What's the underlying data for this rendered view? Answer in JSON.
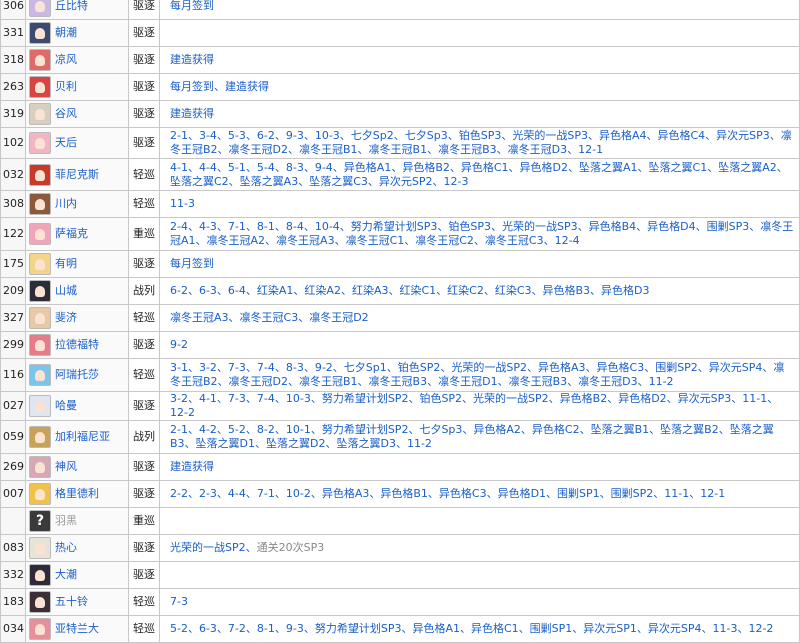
{
  "table": {
    "rows": [
      {
        "id": "306",
        "name": "丘比特",
        "type": "驱逐",
        "avatar_color": "#c9b7e6",
        "sources": [
          "每月签到"
        ]
      },
      {
        "id": "331",
        "name": "朝潮",
        "type": "驱逐",
        "avatar_color": "#3b4a6e",
        "sources": []
      },
      {
        "id": "318",
        "name": "凉风",
        "type": "驱逐",
        "avatar_color": "#e06a6a",
        "sources": [
          "建造获得"
        ]
      },
      {
        "id": "263",
        "name": "贝利",
        "type": "驱逐",
        "avatar_color": "#d84343",
        "sources": [
          "每月签到、建造获得"
        ]
      },
      {
        "id": "319",
        "name": "谷风",
        "type": "驱逐",
        "avatar_color": "#d8cfc0",
        "sources": [
          "建造获得"
        ]
      },
      {
        "id": "102",
        "name": "天后",
        "type": "驱逐",
        "avatar_color": "#f2b5c4",
        "sources": [
          "2-1、3-4、5-3、6-2、9-3、10-3、七夕Sp2、七夕Sp3、铂色SP3、光荣的一战SP3、异色格A4、异色格C4、异次元SP3、凛冬王冠B2、凛冬王冠D2、凛冬王冠B1、凛冬王冠B1、凛冬王冠B3、凛冬王冠D3、12-1"
        ]
      },
      {
        "id": "032",
        "name": "菲尼克斯",
        "type": "轻巡",
        "avatar_color": "#c73a2a",
        "sources": [
          "4-1、4-4、5-1、5-4、8-3、9-4、异色格A1、异色格B2、异色格C1、异色格D2、坠落之翼A1、坠落之翼C1、坠落之翼A2、坠落之翼C2、坠落之翼A3、坠落之翼C3、异次元SP2、12-3"
        ]
      },
      {
        "id": "308",
        "name": "川内",
        "type": "轻巡",
        "avatar_color": "#8a5a3a",
        "sources": [
          "11-3"
        ]
      },
      {
        "id": "122",
        "name": "萨福克",
        "type": "重巡",
        "avatar_color": "#f0a6b8",
        "sources": [
          "2-4、4-3、7-1、8-1、8-4、10-4、努力希望计划SP3、铂色SP3、光荣的一战SP3、异色格B4、异色格D4、围剿SP3、凛冬王冠A1、凛冬王冠A2、凛冬王冠A3、凛冬王冠C1、凛冬王冠C2、凛冬王冠C3、12-4"
        ]
      },
      {
        "id": "175",
        "name": "有明",
        "type": "驱逐",
        "avatar_color": "#f3d58a",
        "sources": [
          "每月签到"
        ]
      },
      {
        "id": "209",
        "name": "山城",
        "type": "战列",
        "avatar_color": "#2d2d3a",
        "sources": [
          "6-2、6-3、6-4、红染A1、红染A2、红染A3、红染C1、红染C2、红染C3、异色格B3、异色格D3"
        ]
      },
      {
        "id": "327",
        "name": "斐济",
        "type": "轻巡",
        "avatar_color": "#e8c9a6",
        "sources": [
          "凛冬王冠A3、凛冬王冠C3、凛冬王冠D2"
        ]
      },
      {
        "id": "299",
        "name": "拉德福特",
        "type": "驱逐",
        "avatar_color": "#e77b8a",
        "sources": [
          "9-2"
        ]
      },
      {
        "id": "116",
        "name": "阿瑞托莎",
        "type": "轻巡",
        "avatar_color": "#7cc4e8",
        "sources": [
          "3-1、3-2、7-3、7-4、8-3、9-2、七夕Sp1、铂色SP2、光荣的一战SP2、异色格A3、异色格C3、围剿SP2、异次元SP4、凛冬王冠B2、凛冬王冠D2、凛冬王冠B1、凛冬王冠B3、凛冬王冠D1、凛冬王冠B3、凛冬王冠D3、11-2"
        ]
      },
      {
        "id": "027",
        "name": "哈曼",
        "type": "驱逐",
        "avatar_color": "#dfe6ef",
        "sources": [
          "3-2、4-1、7-3、7-4、10-3、努力希望计划SP2、铂色SP2、光荣的一战SP2、异色格B2、异色格D2、异次元SP3、11-1、12-2"
        ]
      },
      {
        "id": "059",
        "name": "加利福尼亚",
        "type": "战列",
        "avatar_color": "#c9a25a",
        "sources": [
          "2-1、4-2、5-2、8-2、10-1、努力希望计划SP2、七夕Sp3、异色格A2、异色格C2、坠落之翼B1、坠落之翼B2、坠落之翼B3、坠落之翼D1、坠落之翼D2、坠落之翼D3、11-2"
        ]
      },
      {
        "id": "269",
        "name": "神风",
        "type": "驱逐",
        "avatar_color": "#d8a7b5",
        "sources": [
          "建造获得"
        ]
      },
      {
        "id": "007",
        "name": "格里德利",
        "type": "驱逐",
        "avatar_color": "#f0c24a",
        "sources": [
          "2-2、2-3、4-4、7-1、10-2、异色格A3、异色格B1、异色格C3、异色格D1、围剿SP1、围剿SP2、11-1、12-1"
        ]
      },
      {
        "id": "",
        "name": "羽黑",
        "type": "重巡",
        "avatar_color": "#3a3a3a",
        "unknown": true,
        "unknown_glyph": "?",
        "sources": []
      },
      {
        "id": "083",
        "name": "热心",
        "type": "驱逐",
        "avatar_color": "#e9e2d6",
        "sources": [
          "光荣的一战SP2、"
        ],
        "note": "通关20次SP3"
      },
      {
        "id": "332",
        "name": "大潮",
        "type": "驱逐",
        "avatar_color": "#2e2a3a",
        "sources": []
      },
      {
        "id": "183",
        "name": "五十铃",
        "type": "轻巡",
        "avatar_color": "#3b2f36",
        "sources": [
          "7-3"
        ]
      },
      {
        "id": "034",
        "name": "亚特兰大",
        "type": "轻巡",
        "avatar_color": "#e7909c",
        "sources": [
          "5-2、6-3、7-2、8-1、9-3、努力希望计划SP3、异色格A1、异色格C1、围剿SP1、异次元SP1、异次元SP4、11-3、12-2"
        ]
      }
    ]
  }
}
